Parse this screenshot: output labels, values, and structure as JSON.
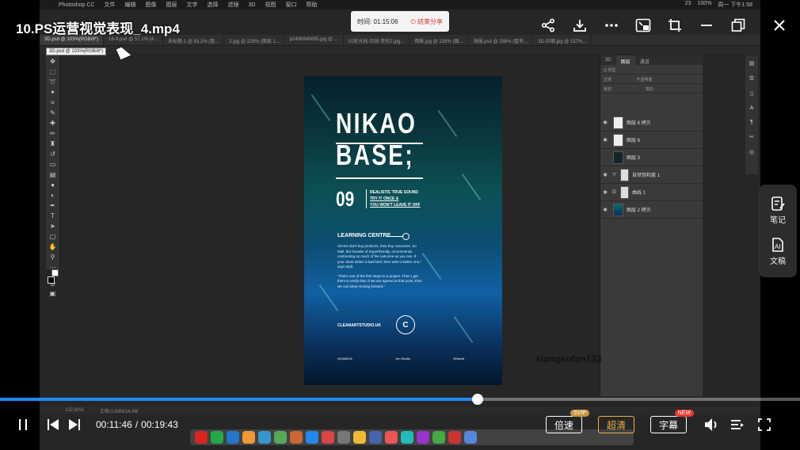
{
  "player": {
    "title": "10.PS运营视觉表现_4.mp4",
    "current_time": "00:11:46",
    "duration": "00:19:43",
    "time_separator": "/",
    "progress": 0.597,
    "speed_label": "倍速",
    "speed_badge": "SVIP",
    "quality_label": "超清",
    "subtitle_label": "字幕",
    "subtitle_badge": "NEW",
    "side_note_label": "笔记",
    "side_doc_label": "文稿",
    "close_icon": "close-icon"
  },
  "recording": {
    "timer": "时间: 01:15:06",
    "end_label": "结束分享"
  },
  "macos": {
    "app": "Photoshop CC",
    "menus": [
      "文件",
      "编辑",
      "图像",
      "图层",
      "文字",
      "选择",
      "滤镜",
      "3D",
      "视图",
      "窗口",
      "帮助"
    ],
    "status": [
      "23",
      "100%",
      "周一 下午1:58"
    ]
  },
  "photoshop": {
    "tabs": [
      "3D.psd @ 103%(RGB/8*)",
      "16-9.psd @ 57.1% (4...",
      "未标题-1 @ 83.2% (智...",
      "2.jpg @ 228% (图层 1...",
      "p2496849695.jpg @ ...",
      "01轮光线-仅线-变形2.jpg...",
      "倒影.jpg @ 138% (图...",
      "海报.psd @ 288% (智有...",
      "3D-拉缩.jpg @ 157%..."
    ],
    "subtab": "3D.psd @ 103%(RGB/8*)",
    "status_zoom": "102.82%",
    "status_doc": "文档:3.60M/14.4M",
    "panel_tabs": [
      "3D",
      "图层",
      "通道"
    ],
    "panel_kind": "Q 类型",
    "panel_mode": "正常",
    "panel_opacity": "不透明度:",
    "panel_lock": "锁定:",
    "panel_fill": "填充:",
    "layers": [
      {
        "name": "图层 6 拷贝",
        "visible": true,
        "thumb": "white"
      },
      {
        "name": "图层 6",
        "visible": true,
        "thumb": "white"
      },
      {
        "name": "图层 3",
        "visible": false,
        "thumb": "dark"
      },
      {
        "name": "自然饱和度 1",
        "visible": true,
        "thumb": "adjust"
      },
      {
        "name": "曲线 1",
        "visible": true,
        "thumb": "curves"
      },
      {
        "name": "图层 2 拷贝",
        "visible": true,
        "thumb": "teal"
      }
    ],
    "watermark": "xiangsufan133"
  },
  "poster": {
    "title_line1": "NIKAO",
    "title_line2": "BASE;",
    "number": "09",
    "tagline": [
      "REALISTIC TRUE SOUND",
      "TRY IT ONCE &",
      "YOU WON'T LEAVE IT OFF"
    ],
    "section": "LEARNING CENTRE",
    "body1": "Clients don't buy products, they buy outcomes. So Mall, the founder of Superfriendly, recommends contracting as much of the outcome as you can. If your client writes a bad brief, then write a better one,\" says Mall.",
    "body2": "\"That's one of the first steps to a project. Then I get them to verify that. If we are agreed at that point, then we can keep moving forward.\"",
    "site": "CLEANARTSTUDIO.UK",
    "logo_letter": "C",
    "footer": [
      "QUAMICA",
      "Jon Studio",
      "DMaxid"
    ]
  }
}
